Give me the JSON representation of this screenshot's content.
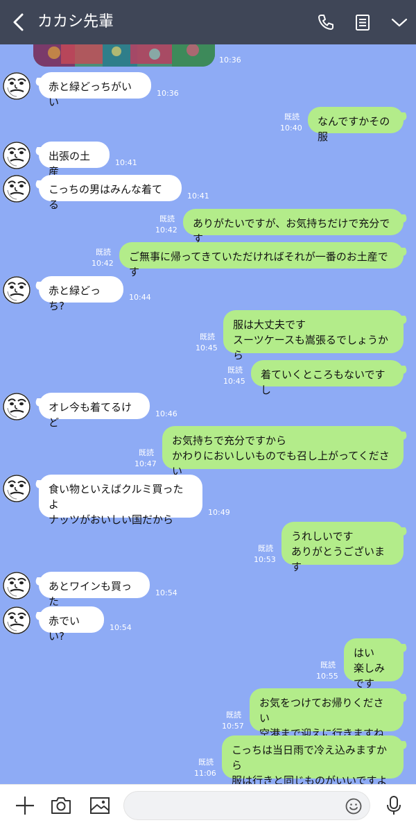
{
  "header": {
    "title": "カカシ先輩",
    "icons": [
      "back-chevron",
      "phone",
      "notes",
      "chevron-down"
    ]
  },
  "messages": [
    {
      "side": "in",
      "text": "赤と緑どっちがいい",
      "time": "10:36"
    },
    {
      "side": "out",
      "text": "なんですかその服",
      "read": "既読",
      "time": "10:40"
    },
    {
      "side": "in",
      "text": "出張の土産",
      "time": "10:41"
    },
    {
      "side": "in",
      "text": "こっちの男はみんな着てる",
      "time": "10:41"
    },
    {
      "side": "out",
      "text": "ありがたいですが、お気持ちだけで充分です",
      "read": "既読",
      "time": "10:42"
    },
    {
      "side": "out",
      "text": "ご無事に帰ってきていただければそれが一番のお土産です",
      "read": "既読",
      "time": "10:42"
    },
    {
      "side": "in",
      "text": "赤と緑どっち?",
      "time": "10:44"
    },
    {
      "side": "out",
      "text": "服は大丈夫です\nスーツケースも嵩張るでしょうから",
      "read": "既読",
      "time": "10:45"
    },
    {
      "side": "out",
      "text": "着ていくところもないですし",
      "read": "既読",
      "time": "10:45"
    },
    {
      "side": "in",
      "text": "オレ今も着てるけど",
      "time": "10:46"
    },
    {
      "side": "out",
      "text": "お気持ちで充分ですから\nかわりにおいしいものでも召し上がってください",
      "read": "既読",
      "time": "10:47"
    },
    {
      "side": "in",
      "text": "食い物といえばクルミ買ったよ\nナッツがおいしい国だから",
      "time": "10:49"
    },
    {
      "side": "out",
      "text": "うれしいです\nありがとうございます",
      "read": "既読",
      "time": "10:53"
    },
    {
      "side": "in",
      "text": "あとワインも買った",
      "time": "10:54"
    },
    {
      "side": "in",
      "text": "赤でいい?",
      "time": "10:54"
    },
    {
      "side": "out",
      "text": "はい\n楽しみです",
      "read": "既読",
      "time": "10:55"
    },
    {
      "side": "out",
      "text": "お気をつけてお帰りください\n空港まで迎えに行きますね",
      "read": "既読",
      "time": "10:57"
    },
    {
      "side": "out",
      "text": "こっちは当日雨で冷え込みますから\n服は行きと同じものがいいですよ",
      "read": "既読",
      "time": "11:06"
    }
  ],
  "photo_time": "10:36",
  "footer": {
    "icons": [
      "plus",
      "camera",
      "image",
      "emoji",
      "microphone"
    ],
    "input_placeholder": "",
    "input_value": ""
  },
  "colors": {
    "header_bg": "#3f4657",
    "chat_bg": "#8eabf5",
    "out_bubble": "#b3ec8a",
    "in_bubble": "#ffffff"
  }
}
